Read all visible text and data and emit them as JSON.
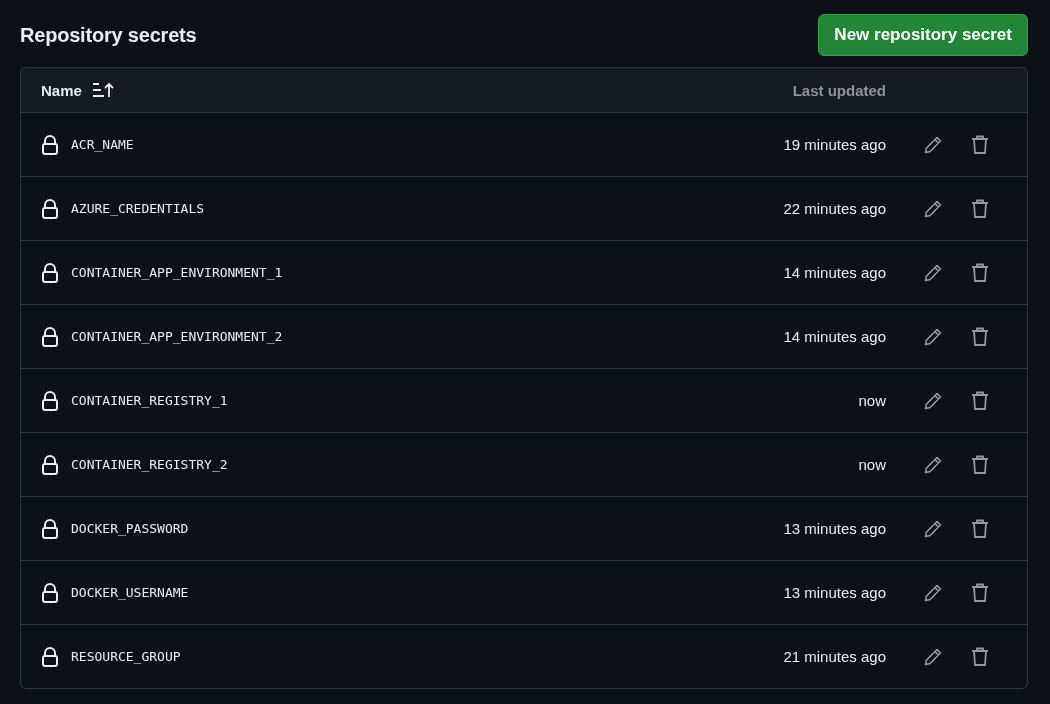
{
  "title": "Repository secrets",
  "new_button": "New repository secret",
  "table": {
    "columns": [
      "Name",
      "Last updated"
    ],
    "rows": [
      {
        "name": "ACR_NAME",
        "updated": "19 minutes ago"
      },
      {
        "name": "AZURE_CREDENTIALS",
        "updated": "22 minutes ago"
      },
      {
        "name": "CONTAINER_APP_ENVIRONMENT_1",
        "updated": "14 minutes ago"
      },
      {
        "name": "CONTAINER_APP_ENVIRONMENT_2",
        "updated": "14 minutes ago"
      },
      {
        "name": "CONTAINER_REGISTRY_1",
        "updated": "now"
      },
      {
        "name": "CONTAINER_REGISTRY_2",
        "updated": "now"
      },
      {
        "name": "DOCKER_PASSWORD",
        "updated": "13 minutes ago"
      },
      {
        "name": "DOCKER_USERNAME",
        "updated": "13 minutes ago"
      },
      {
        "name": "RESOURCE_GROUP",
        "updated": "21 minutes ago"
      }
    ]
  }
}
